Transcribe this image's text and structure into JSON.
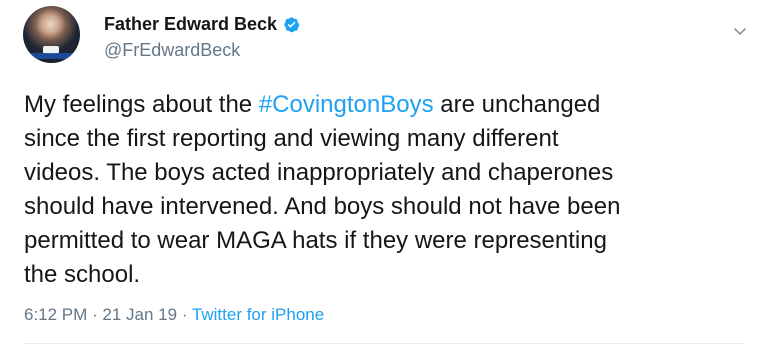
{
  "author": {
    "display_name": "Father Edward Beck",
    "handle": "@FrEdwardBeck",
    "verified": true
  },
  "tweet": {
    "line1_before": "My feelings about the ",
    "hashtag": "#CovingtonBoys",
    "line1_after": " are unchanged",
    "line2": "since the first reporting and viewing many different",
    "line3": "videos. The boys acted inappropriately and chaperones",
    "line4": "should have intervened. And boys should not have been",
    "line5": "permitted to wear MAGA hats if they were representing",
    "line6": "the school."
  },
  "meta": {
    "time": "6:12 PM",
    "separator": " · ",
    "date": "21 Jan 19",
    "source": "Twitter for iPhone"
  },
  "colors": {
    "link": "#1da1f2",
    "secondary_text": "#657786",
    "primary_text": "#14171a"
  },
  "icons": {
    "verified": "verified-badge-icon",
    "menu": "chevron-down-icon"
  }
}
